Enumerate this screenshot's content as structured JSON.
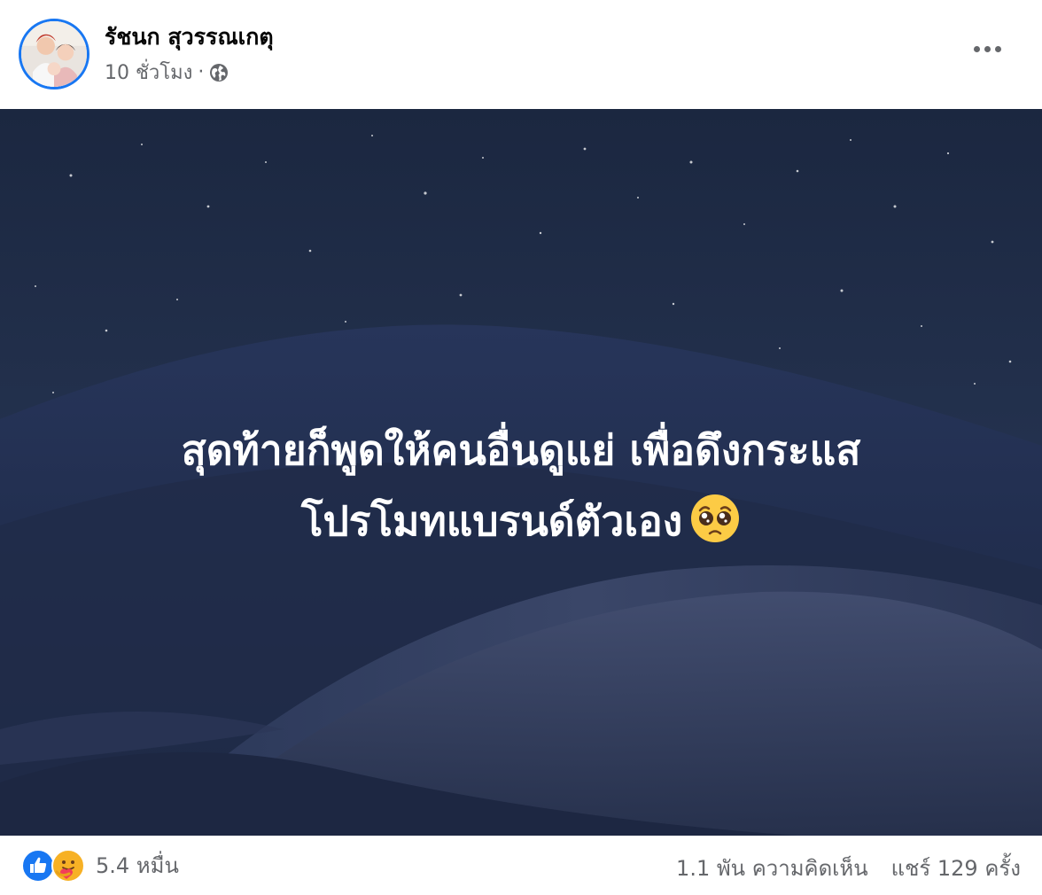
{
  "post": {
    "author_name": "รัชนก สุวรรณเกตุ",
    "time": "10 ชั่วโมง",
    "separator": "·",
    "privacy_icon": "globe-icon",
    "menu_icon": "more-options-icon",
    "text_line1": "สุดท้ายก็พูดให้คนอื่นดูแย่ เพื่อดึงกระแส",
    "text_line2": "โปรโมทแบรนด์ตัวเอง",
    "text_emoji": "pleading-face-emoji",
    "background": "night-desert-dunes"
  },
  "footer": {
    "reaction_icons": [
      "like-icon",
      "care-icon"
    ],
    "reaction_count": "5.4 หมื่น",
    "comments": "1.1 พัน ความคิดเห็น",
    "shares": "แชร์ 129 ครั้ง"
  },
  "colors": {
    "accent": "#1877f2",
    "secondary_text": "#65676b",
    "primary_text": "#050505"
  }
}
